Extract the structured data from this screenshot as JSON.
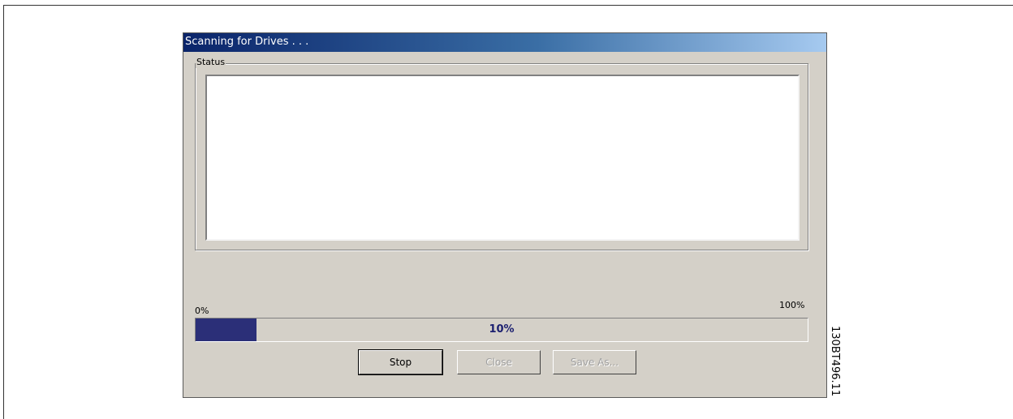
{
  "dialog": {
    "title": "Scanning for Drives . . ."
  },
  "status": {
    "group_label": "Status",
    "content": ""
  },
  "progress": {
    "min_label": "0%",
    "max_label": "100%",
    "value": 10,
    "value_label": "10%",
    "fill_color": "#2b2f78"
  },
  "buttons": {
    "stop": {
      "label": "Stop",
      "enabled": true
    },
    "close": {
      "label": "Close",
      "enabled": false
    },
    "save_as": {
      "label": "Save As...",
      "enabled": false
    }
  },
  "figure": {
    "code": "130BT496.11"
  }
}
